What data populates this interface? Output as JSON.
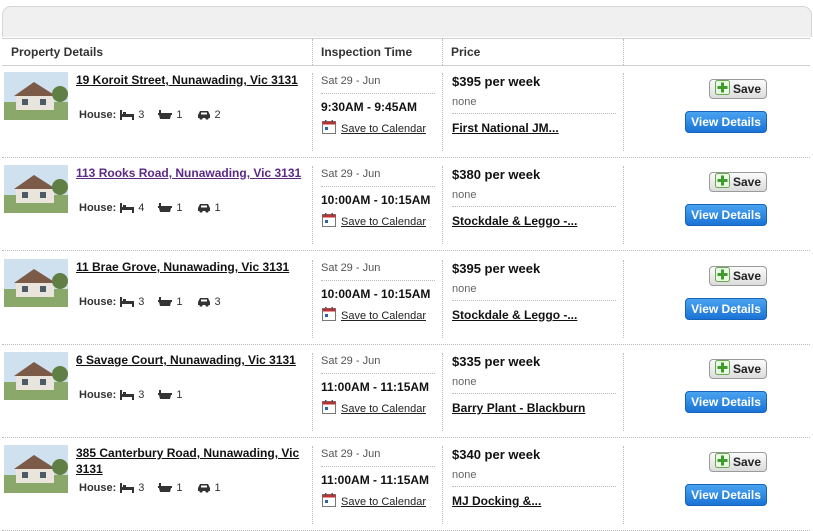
{
  "header": {
    "col_property": "Property Details",
    "col_inspection": "Inspection Time",
    "col_price": "Price"
  },
  "listings": [
    {
      "address": "19 Koroit Street, Nunawading, Vic 3131",
      "house_label": "House:",
      "beds": "3",
      "baths": "1",
      "cars": "2",
      "date": "Sat 29 - Jun",
      "time": "9:30AM - 9:45AM",
      "calendar": "Save to Calendar",
      "price": "$395 per week",
      "bond": "none",
      "agent": "First National JM...",
      "save": "Save",
      "view": "View Details",
      "visited": false
    },
    {
      "address": "113 Rooks Road, Nunawading, Vic 3131",
      "house_label": "House:",
      "beds": "4",
      "baths": "1",
      "cars": "1",
      "date": "Sat 29 - Jun",
      "time": "10:00AM - 10:15AM",
      "calendar": "Save to Calendar",
      "price": "$380 per week",
      "bond": "none",
      "agent": "Stockdale & Leggo -...",
      "save": "Save",
      "view": "View Details",
      "visited": true
    },
    {
      "address": "11 Brae Grove, Nunawading, Vic 3131",
      "house_label": "House:",
      "beds": "3",
      "baths": "1",
      "cars": "3",
      "date": "Sat 29 - Jun",
      "time": "10:00AM - 10:15AM",
      "calendar": "Save to Calendar",
      "price": "$395 per week",
      "bond": "none",
      "agent": "Stockdale & Leggo -...",
      "save": "Save",
      "view": "View Details",
      "visited": false
    },
    {
      "address": "6 Savage Court, Nunawading, Vic 3131",
      "house_label": "House:",
      "beds": "3",
      "baths": "1",
      "cars": "",
      "date": "Sat 29 - Jun",
      "time": "11:00AM - 11:15AM",
      "calendar": "Save to Calendar",
      "price": "$335 per week",
      "bond": "none",
      "agent": "Barry Plant - Blackburn",
      "save": "Save",
      "view": "View Details",
      "visited": false
    },
    {
      "address": "385 Canterbury Road, Nunawading, Vic 3131",
      "house_label": "House:",
      "beds": "3",
      "baths": "1",
      "cars": "1",
      "date": "Sat 29 - Jun",
      "time": "11:00AM - 11:15AM",
      "calendar": "Save to Calendar",
      "price": "$340 per week",
      "bond": "none",
      "agent": "MJ Docking &...",
      "save": "Save",
      "view": "View Details",
      "visited": false
    }
  ],
  "icons": {
    "bed": "bed-icon",
    "bath": "bath-icon",
    "car": "car-icon",
    "calendar": "calendar-icon",
    "save_plus": "plus-icon"
  },
  "colors": {
    "link": "#111111",
    "visited_link": "#5b2a86",
    "view_button": "#1a73d6",
    "header_bg": "#f0f0f0"
  }
}
